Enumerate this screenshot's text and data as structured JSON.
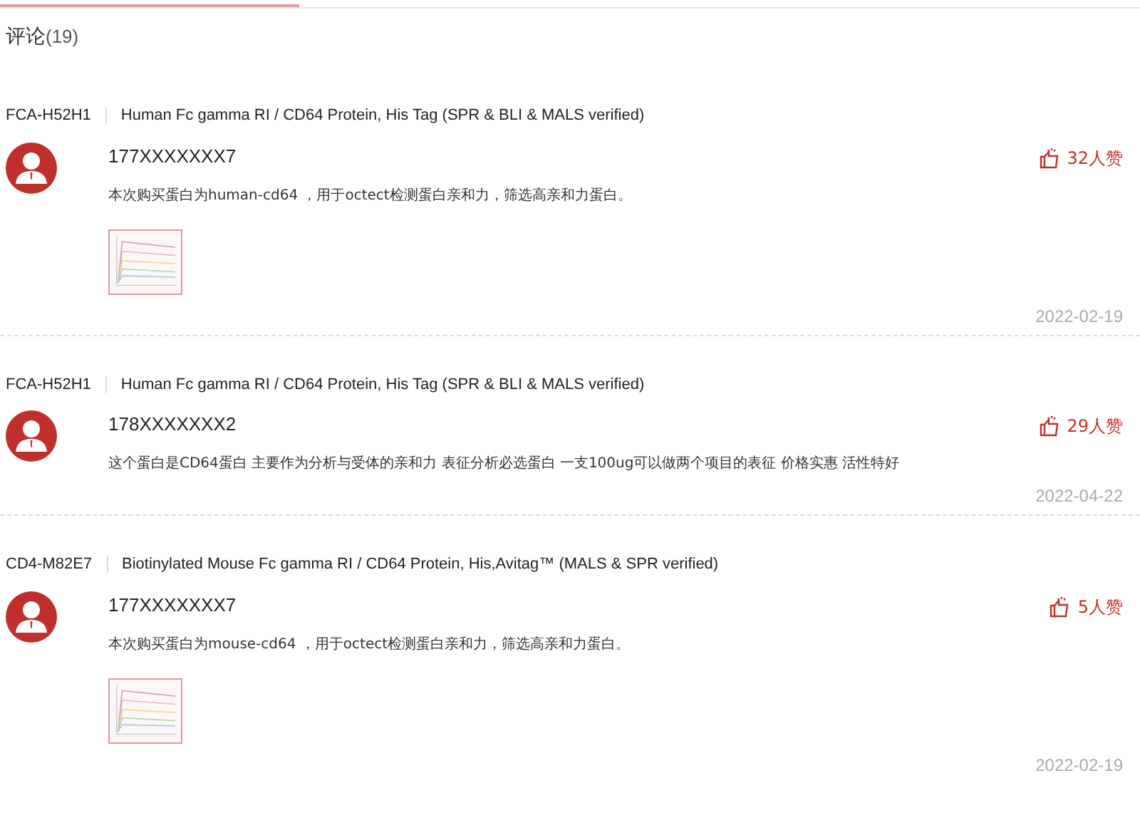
{
  "title": "评论",
  "count": "(19)",
  "comments": [
    {
      "sku": "FCA-H52H1",
      "product": "Human Fc gamma RI / CD64 Protein, His Tag (SPR & BLI & MALS verified)",
      "user": "177XXXXXXX7",
      "likes": "32人赞",
      "text": "本次购买蛋白为human-cd64 ，用于octect检测蛋白亲和力，筛选高亲和力蛋白。",
      "date": "2022-02-19"
    },
    {
      "sku": "FCA-H52H1",
      "product": "Human Fc gamma RI / CD64 Protein, His Tag (SPR & BLI & MALS verified)",
      "user": "178XXXXXXX2",
      "likes": "29人赞",
      "text": "这个蛋白是CD64蛋白 主要作为分析与受体的亲和力 表征分析必选蛋白 一支100ug可以做两个项目的表征 价格实惠 活性特好",
      "date": "2022-04-22"
    },
    {
      "sku": "CD4-M82E7",
      "product": "Biotinylated Mouse Fc gamma RI / CD64 Protein, His,Avitag™ (MALS & SPR verified)",
      "user": "177XXXXXXX7",
      "likes": "5人赞",
      "text": "本次购买蛋白为mouse-cd64 ，用于octect检测蛋白亲和力，筛选高亲和力蛋白。",
      "date": "2022-02-19"
    }
  ]
}
